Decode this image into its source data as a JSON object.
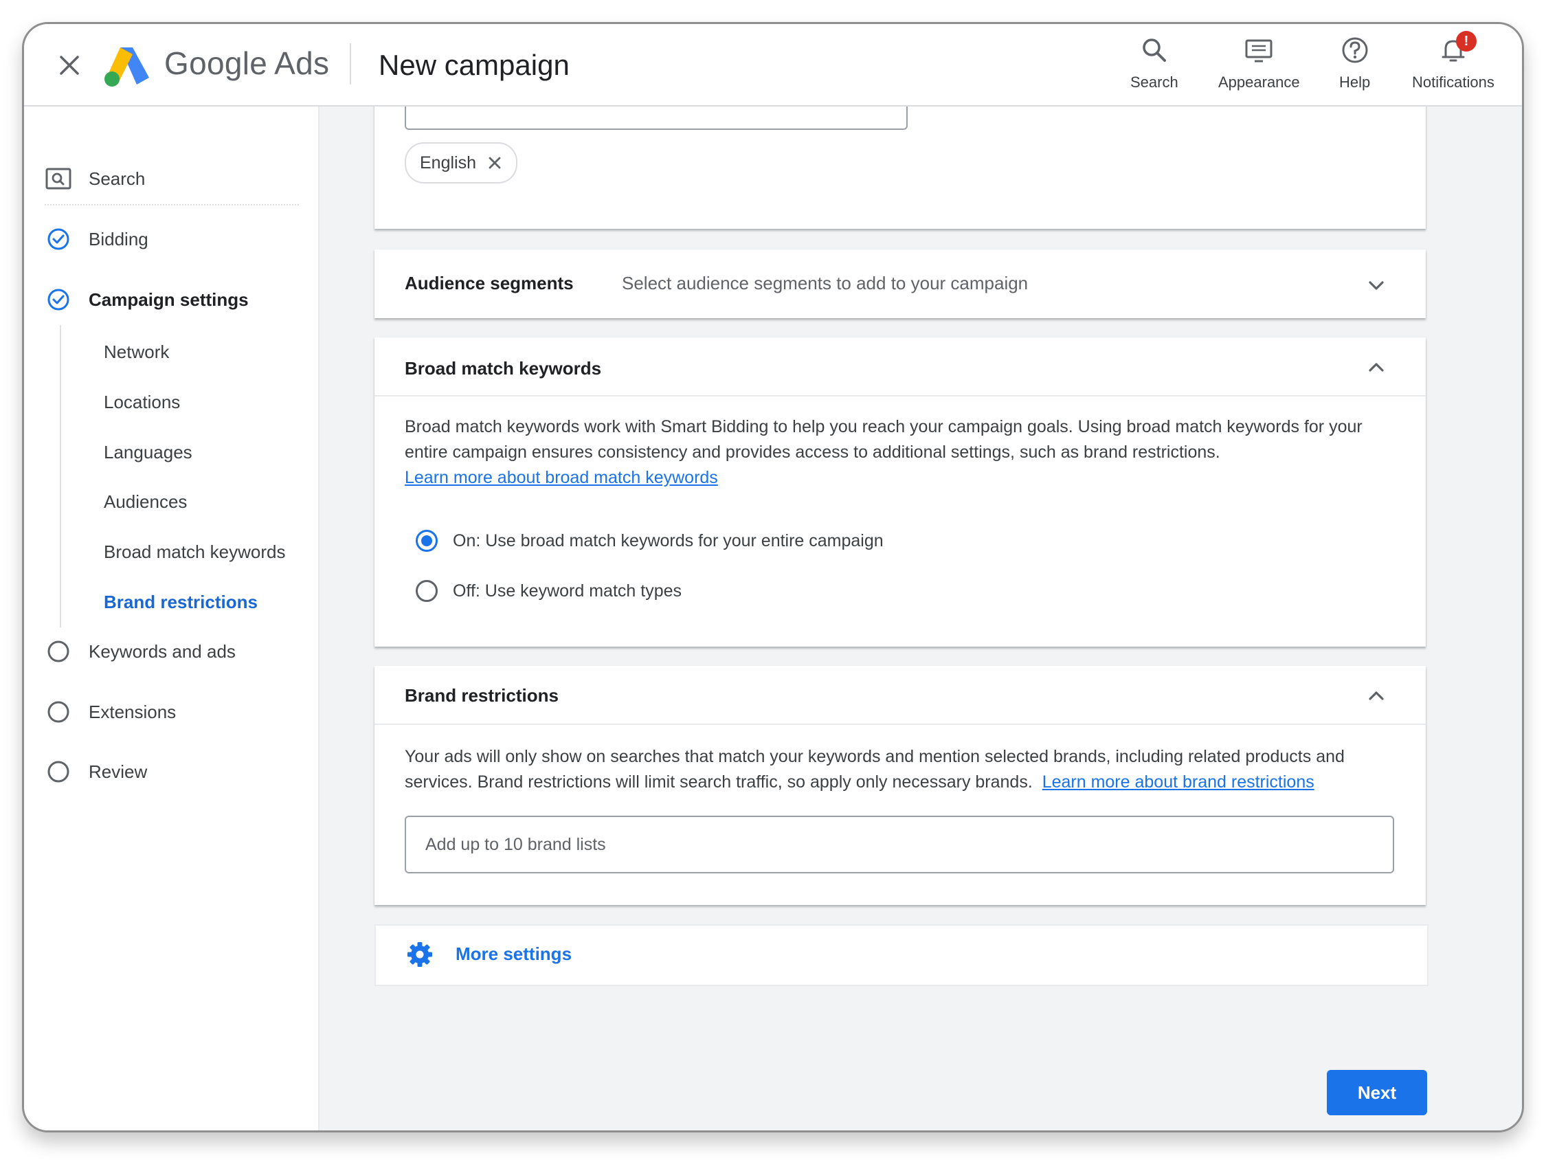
{
  "header": {
    "brand_google": "Google",
    "brand_ads": "Ads",
    "page_title": "New campaign",
    "actions": {
      "search": "Search",
      "appearance": "Appearance",
      "help": "Help",
      "notifications": "Notifications",
      "notifications_badge": "!"
    }
  },
  "sidebar": {
    "search": "Search",
    "bidding": "Bidding",
    "campaign_settings": "Campaign settings",
    "sub_items": [
      "Network",
      "Locations",
      "Languages",
      "Audiences",
      "Broad match keywords",
      "Brand restrictions"
    ],
    "active_sub_item": "Brand restrictions",
    "keywords_and_ads": "Keywords and ads",
    "extensions": "Extensions",
    "review": "Review"
  },
  "languages": {
    "chip": "English"
  },
  "audience_segments": {
    "title": "Audience segments",
    "subtitle": "Select audience segments to add to your campaign"
  },
  "broad_match": {
    "title": "Broad match keywords",
    "description": "Broad match keywords work with Smart Bidding to help you reach your campaign goals. Using broad match keywords for your entire campaign ensures consistency and provides access to additional settings, such as brand restrictions.",
    "learn_more": "Learn more about broad match keywords",
    "option_on": "On: Use broad match keywords for your entire campaign",
    "option_off": "Off: Use keyword match types",
    "selected": "on"
  },
  "brand_restrictions": {
    "title": "Brand restrictions",
    "description": "Your ads will only show on searches that match your keywords and mention selected brands, including related products and services. Brand restrictions will limit search traffic, so apply only necessary brands.",
    "learn_more": "Learn more about brand restrictions",
    "input_placeholder": "Add up to 10 brand lists"
  },
  "more_settings": "More settings",
  "next_button": "Next",
  "colors": {
    "accent": "#1a73e8",
    "badge": "#d93025",
    "check": "#1a73e8",
    "logo_yellow": "#fbbc04",
    "logo_blue": "#4285f4",
    "logo_green": "#34a853"
  }
}
